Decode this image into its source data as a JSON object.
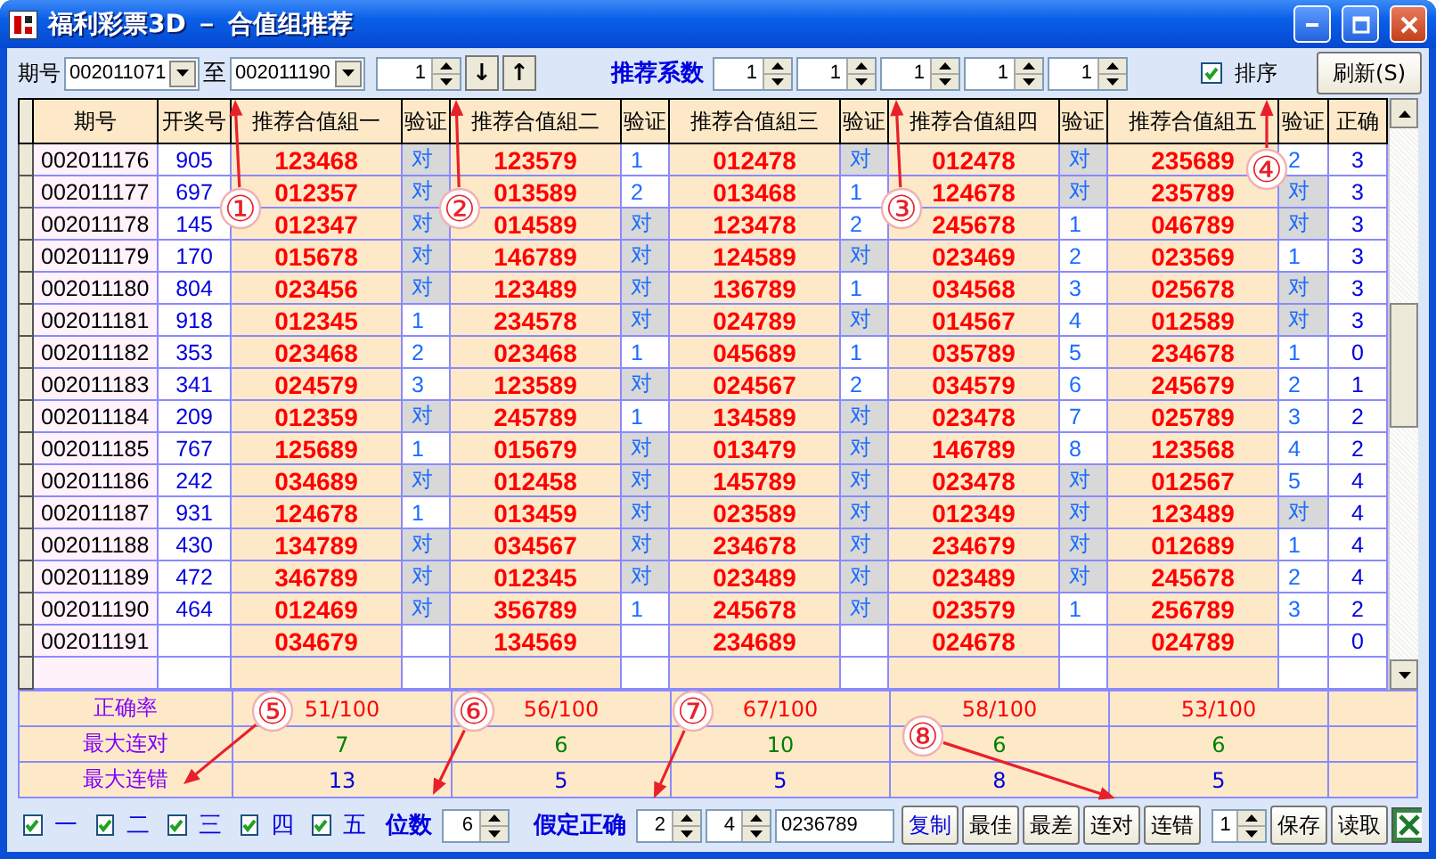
{
  "window": {
    "title": "福利彩票3D － 合值组推荐"
  },
  "toolbar": {
    "issue_label": "期号",
    "from": "002011071",
    "to_label": "至",
    "to": "002011190",
    "step": "1",
    "down": "↓",
    "up": "↑",
    "coef_label": "推荐系数",
    "coefs": [
      "1",
      "1",
      "1",
      "1",
      "1"
    ],
    "sort": {
      "label": "排序",
      "checked": true
    },
    "refresh": "刷新(S)"
  },
  "table": {
    "columns": [
      "期号",
      "开奖号",
      "推荐合值組一",
      "验证",
      "推荐合值組二",
      "验证",
      "推荐合值組三",
      "验证",
      "推荐合值組四",
      "验证",
      "推荐合值組五",
      "验证",
      "正确"
    ],
    "rows": [
      {
        "issue": "002011176",
        "draw": "905",
        "groups": [
          {
            "combo": "123468",
            "check": "对",
            "hit": true
          },
          {
            "combo": "123579",
            "check": "1",
            "hit": false
          },
          {
            "combo": "012478",
            "check": "对",
            "hit": true
          },
          {
            "combo": "012478",
            "check": "对",
            "hit": true
          },
          {
            "combo": "235689",
            "check": "2",
            "hit": false
          }
        ],
        "correct": "3"
      },
      {
        "issue": "002011177",
        "draw": "697",
        "groups": [
          {
            "combo": "012357",
            "check": "对",
            "hit": true
          },
          {
            "combo": "013589",
            "check": "2",
            "hit": false
          },
          {
            "combo": "013468",
            "check": "1",
            "hit": false
          },
          {
            "combo": "124678",
            "check": "对",
            "hit": true
          },
          {
            "combo": "235789",
            "check": "对",
            "hit": true
          }
        ],
        "correct": "3"
      },
      {
        "issue": "002011178",
        "draw": "145",
        "groups": [
          {
            "combo": "012347",
            "check": "对",
            "hit": true
          },
          {
            "combo": "014589",
            "check": "对",
            "hit": true
          },
          {
            "combo": "123478",
            "check": "2",
            "hit": false
          },
          {
            "combo": "245678",
            "check": "1",
            "hit": false
          },
          {
            "combo": "046789",
            "check": "对",
            "hit": true
          }
        ],
        "correct": "3"
      },
      {
        "issue": "002011179",
        "draw": "170",
        "groups": [
          {
            "combo": "015678",
            "check": "对",
            "hit": true
          },
          {
            "combo": "146789",
            "check": "对",
            "hit": true
          },
          {
            "combo": "124589",
            "check": "对",
            "hit": true
          },
          {
            "combo": "023469",
            "check": "2",
            "hit": false
          },
          {
            "combo": "023569",
            "check": "1",
            "hit": false
          }
        ],
        "correct": "3"
      },
      {
        "issue": "002011180",
        "draw": "804",
        "groups": [
          {
            "combo": "023456",
            "check": "对",
            "hit": true
          },
          {
            "combo": "123489",
            "check": "对",
            "hit": true
          },
          {
            "combo": "136789",
            "check": "1",
            "hit": false
          },
          {
            "combo": "034568",
            "check": "3",
            "hit": false
          },
          {
            "combo": "025678",
            "check": "对",
            "hit": true
          }
        ],
        "correct": "3"
      },
      {
        "issue": "002011181",
        "draw": "918",
        "groups": [
          {
            "combo": "012345",
            "check": "1",
            "hit": false
          },
          {
            "combo": "234578",
            "check": "对",
            "hit": true
          },
          {
            "combo": "024789",
            "check": "对",
            "hit": true
          },
          {
            "combo": "014567",
            "check": "4",
            "hit": false
          },
          {
            "combo": "012589",
            "check": "对",
            "hit": true
          }
        ],
        "correct": "3"
      },
      {
        "issue": "002011182",
        "draw": "353",
        "groups": [
          {
            "combo": "023468",
            "check": "2",
            "hit": false
          },
          {
            "combo": "023468",
            "check": "1",
            "hit": false
          },
          {
            "combo": "045689",
            "check": "1",
            "hit": false
          },
          {
            "combo": "035789",
            "check": "5",
            "hit": false
          },
          {
            "combo": "234678",
            "check": "1",
            "hit": false
          }
        ],
        "correct": "0"
      },
      {
        "issue": "002011183",
        "draw": "341",
        "groups": [
          {
            "combo": "024579",
            "check": "3",
            "hit": false
          },
          {
            "combo": "123589",
            "check": "对",
            "hit": true
          },
          {
            "combo": "024567",
            "check": "2",
            "hit": false
          },
          {
            "combo": "034579",
            "check": "6",
            "hit": false
          },
          {
            "combo": "245679",
            "check": "2",
            "hit": false
          }
        ],
        "correct": "1"
      },
      {
        "issue": "002011184",
        "draw": "209",
        "groups": [
          {
            "combo": "012359",
            "check": "对",
            "hit": true
          },
          {
            "combo": "245789",
            "check": "1",
            "hit": false
          },
          {
            "combo": "134589",
            "check": "对",
            "hit": true
          },
          {
            "combo": "023478",
            "check": "7",
            "hit": false
          },
          {
            "combo": "025789",
            "check": "3",
            "hit": false
          }
        ],
        "correct": "2"
      },
      {
        "issue": "002011185",
        "draw": "767",
        "groups": [
          {
            "combo": "125689",
            "check": "1",
            "hit": false
          },
          {
            "combo": "015679",
            "check": "对",
            "hit": true
          },
          {
            "combo": "013479",
            "check": "对",
            "hit": true
          },
          {
            "combo": "146789",
            "check": "8",
            "hit": false
          },
          {
            "combo": "123568",
            "check": "4",
            "hit": false
          }
        ],
        "correct": "2"
      },
      {
        "issue": "002011186",
        "draw": "242",
        "groups": [
          {
            "combo": "034689",
            "check": "对",
            "hit": true
          },
          {
            "combo": "012458",
            "check": "对",
            "hit": true
          },
          {
            "combo": "145789",
            "check": "对",
            "hit": true
          },
          {
            "combo": "023478",
            "check": "对",
            "hit": true
          },
          {
            "combo": "012567",
            "check": "5",
            "hit": false
          }
        ],
        "correct": "4"
      },
      {
        "issue": "002011187",
        "draw": "931",
        "groups": [
          {
            "combo": "124678",
            "check": "1",
            "hit": false
          },
          {
            "combo": "013459",
            "check": "对",
            "hit": true
          },
          {
            "combo": "023589",
            "check": "对",
            "hit": true
          },
          {
            "combo": "012349",
            "check": "对",
            "hit": true
          },
          {
            "combo": "123489",
            "check": "对",
            "hit": true
          }
        ],
        "correct": "4"
      },
      {
        "issue": "002011188",
        "draw": "430",
        "groups": [
          {
            "combo": "134789",
            "check": "对",
            "hit": true
          },
          {
            "combo": "034567",
            "check": "对",
            "hit": true
          },
          {
            "combo": "234678",
            "check": "对",
            "hit": true
          },
          {
            "combo": "234679",
            "check": "对",
            "hit": true
          },
          {
            "combo": "012689",
            "check": "1",
            "hit": false
          }
        ],
        "correct": "4"
      },
      {
        "issue": "002011189",
        "draw": "472",
        "groups": [
          {
            "combo": "346789",
            "check": "对",
            "hit": true
          },
          {
            "combo": "012345",
            "check": "对",
            "hit": true
          },
          {
            "combo": "023489",
            "check": "对",
            "hit": true
          },
          {
            "combo": "023489",
            "check": "对",
            "hit": true
          },
          {
            "combo": "245678",
            "check": "2",
            "hit": false
          }
        ],
        "correct": "4"
      },
      {
        "issue": "002011190",
        "draw": "464",
        "groups": [
          {
            "combo": "012469",
            "check": "对",
            "hit": true
          },
          {
            "combo": "356789",
            "check": "1",
            "hit": false
          },
          {
            "combo": "245678",
            "check": "对",
            "hit": true
          },
          {
            "combo": "023579",
            "check": "1",
            "hit": false
          },
          {
            "combo": "256789",
            "check": "3",
            "hit": false
          }
        ],
        "correct": "2"
      },
      {
        "issue": "002011191",
        "groups": [
          {
            "combo": "034679",
            "hit": false
          },
          {
            "combo": "134569",
            "hit": false
          },
          {
            "combo": "234689",
            "hit": false
          },
          {
            "combo": "024678",
            "hit": false
          },
          {
            "combo": "024789",
            "hit": false
          }
        ],
        "correct": "0"
      }
    ]
  },
  "summary": [
    {
      "kind": "rate",
      "label": "正确率",
      "values": [
        "51/100",
        "56/100",
        "67/100",
        "58/100",
        "53/100"
      ]
    },
    {
      "kind": "max_hit",
      "label": "最大连对",
      "values": [
        "7",
        "6",
        "10",
        "6",
        "6"
      ]
    },
    {
      "kind": "max_miss",
      "label": "最大连错",
      "values": [
        "13",
        "5",
        "5",
        "8",
        "5"
      ]
    }
  ],
  "bottom": {
    "groups": [
      {
        "label": "一",
        "checked": true
      },
      {
        "label": "二",
        "checked": true
      },
      {
        "label": "三",
        "checked": true
      },
      {
        "label": "四",
        "checked": true
      },
      {
        "label": "五",
        "checked": true
      }
    ],
    "digits_label": "位数",
    "digits": "6",
    "assume_label": "假定正确",
    "assume_a": "2",
    "assume_b": "4",
    "numbers": "0236789",
    "buttons": [
      {
        "label": "复制",
        "default": true
      },
      {
        "label": "最佳",
        "default": false
      },
      {
        "label": "最差",
        "default": false
      },
      {
        "label": "连对",
        "default": false
      },
      {
        "label": "连错",
        "default": false
      }
    ],
    "page": "1",
    "save": "保存",
    "load": "读取"
  },
  "callouts": [
    "①",
    "②",
    "③",
    "④",
    "⑤",
    "⑥",
    "⑦",
    "⑧"
  ]
}
